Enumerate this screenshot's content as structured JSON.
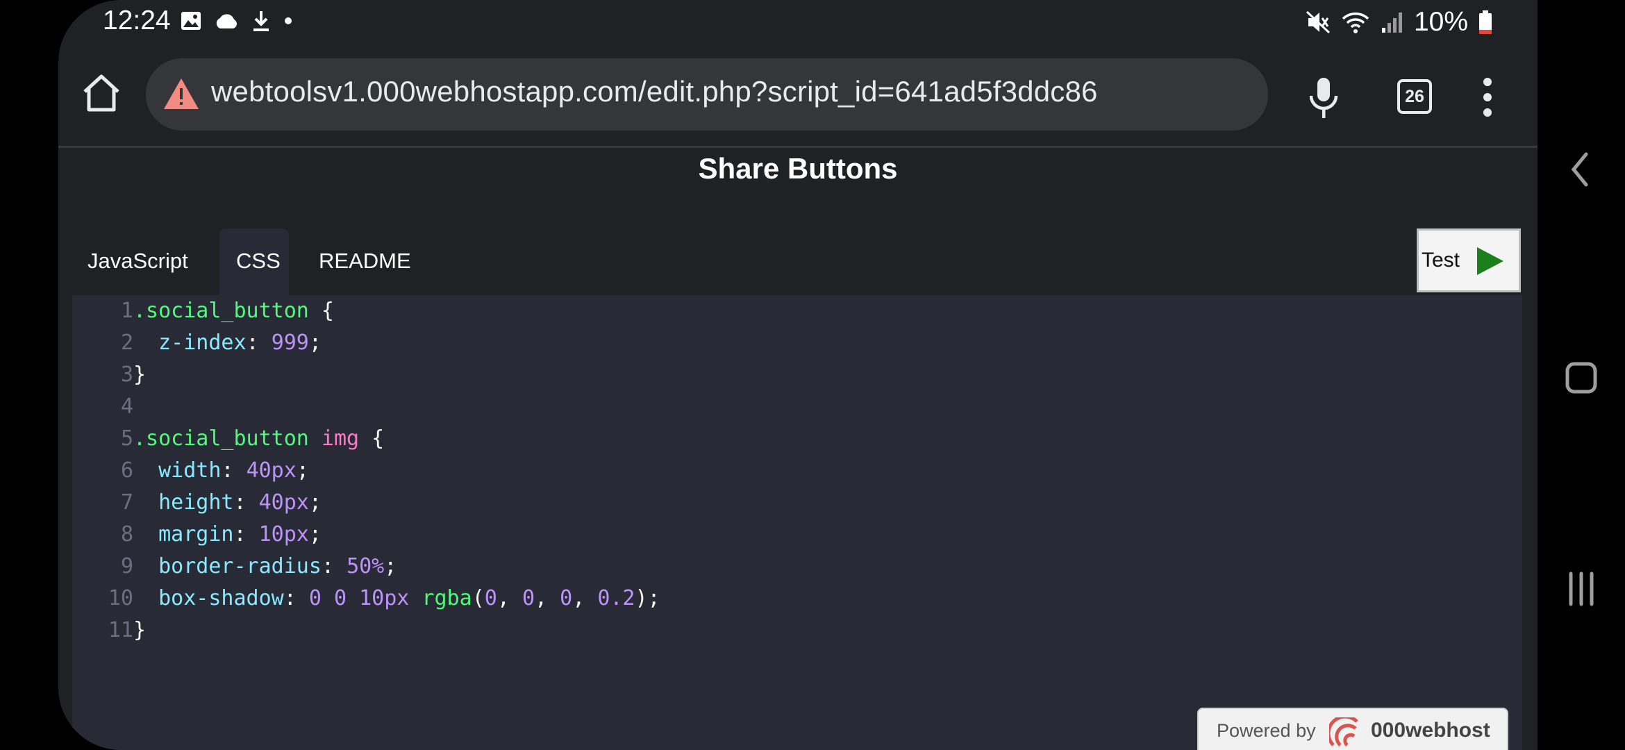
{
  "status_bar": {
    "time": "12:24",
    "left_icons": [
      "image-icon",
      "cloud-icon",
      "download-icon",
      "dot-icon"
    ],
    "right_icons": [
      "mute-icon",
      "wifi-icon",
      "signal-icon",
      "battery-icon"
    ],
    "battery": "10%"
  },
  "browser": {
    "url": "webtoolsv1.000webhostapp.com/edit.php?script_id=641ad5f3ddc86",
    "tab_count": "26"
  },
  "page": {
    "title": "Share Buttons",
    "tabs": [
      {
        "label": "JavaScript",
        "active": false
      },
      {
        "label": "CSS",
        "active": true
      },
      {
        "label": "README",
        "active": false
      }
    ],
    "test_label": "Test"
  },
  "editor": {
    "line_numbers": [
      "1",
      "2",
      "3",
      "4",
      "5",
      "6",
      "7",
      "8",
      "9",
      "10",
      "11"
    ]
  },
  "footer": {
    "powered_by": "Powered by",
    "brand": "000webhost"
  },
  "colors": {
    "background": "#202124",
    "editor_bg": "#282a36",
    "selector": "#50fa7b",
    "property": "#8be9fd",
    "number": "#bd93f9",
    "tag": "#ff79c6",
    "play": "#1b7f1b"
  }
}
